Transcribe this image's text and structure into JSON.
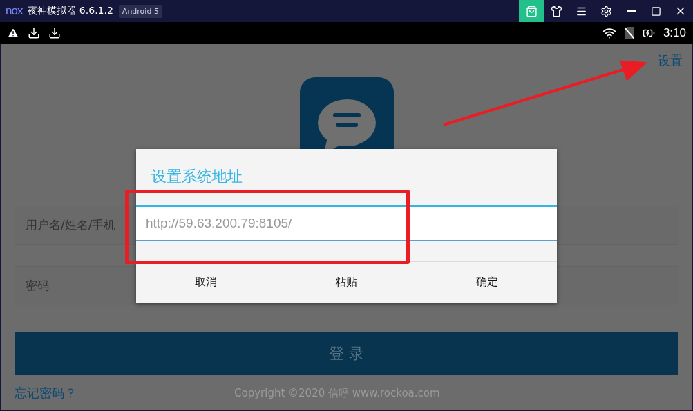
{
  "window": {
    "logo": "nox",
    "title": "夜神模拟器 6.6.1.2",
    "badge": "Android 5"
  },
  "status_bar": {
    "time": "3:10"
  },
  "login": {
    "settings_link": "设置",
    "username_placeholder": "用户名/姓名/手机",
    "password_placeholder": "密码",
    "login_button": "登 录",
    "forgot_link": "忘记密码？",
    "copyright": "Copyright ©2020 信呼 www.rockoa.com"
  },
  "dialog": {
    "title": "设置系统地址",
    "value": "http://59.63.200.79:8105/",
    "buttons": [
      "取消",
      "粘贴",
      "确定"
    ]
  }
}
